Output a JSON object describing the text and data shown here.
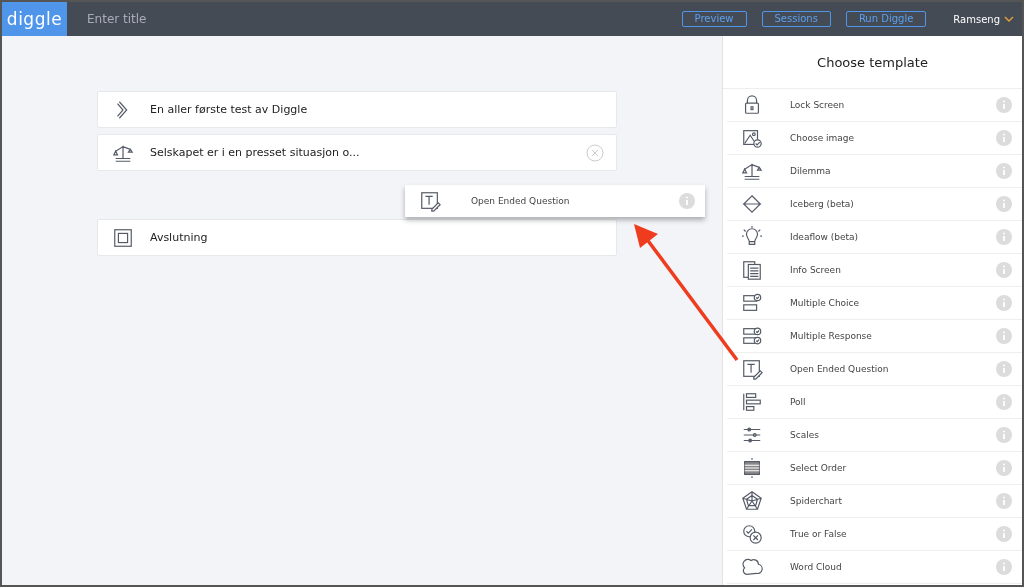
{
  "topbar": {
    "logo": "diggle",
    "title_placeholder": "Enter title",
    "buttons": [
      "Preview",
      "Sessions",
      "Run Diggle"
    ],
    "user": "Ramseng"
  },
  "steps": [
    {
      "kind": "start",
      "label": "En aller første test av Diggle",
      "removable": false
    },
    {
      "kind": "dilemma",
      "label": "Selskapet er i en presset situasjon o...",
      "removable": true
    },
    {
      "kind": "end",
      "label": "Avslutning",
      "removable": false
    }
  ],
  "dragged_item": {
    "kind": "open",
    "label": "Open Ended Question"
  },
  "template_panel": {
    "title": "Choose template",
    "items": [
      {
        "kind": "lock",
        "label": "Lock Screen"
      },
      {
        "kind": "image",
        "label": "Choose image"
      },
      {
        "kind": "dilemma",
        "label": "Dilemma"
      },
      {
        "kind": "iceberg",
        "label": "Iceberg (beta)"
      },
      {
        "kind": "idea",
        "label": "Ideaflow (beta)"
      },
      {
        "kind": "info",
        "label": "Info Screen"
      },
      {
        "kind": "choice",
        "label": "Multiple Choice"
      },
      {
        "kind": "response",
        "label": "Multiple Response"
      },
      {
        "kind": "open",
        "label": "Open Ended Question"
      },
      {
        "kind": "poll",
        "label": "Poll"
      },
      {
        "kind": "scales",
        "label": "Scales"
      },
      {
        "kind": "order",
        "label": "Select Order"
      },
      {
        "kind": "spider",
        "label": "Spiderchart"
      },
      {
        "kind": "truefalse",
        "label": "True or False"
      },
      {
        "kind": "cloud",
        "label": "Word Cloud"
      }
    ]
  }
}
